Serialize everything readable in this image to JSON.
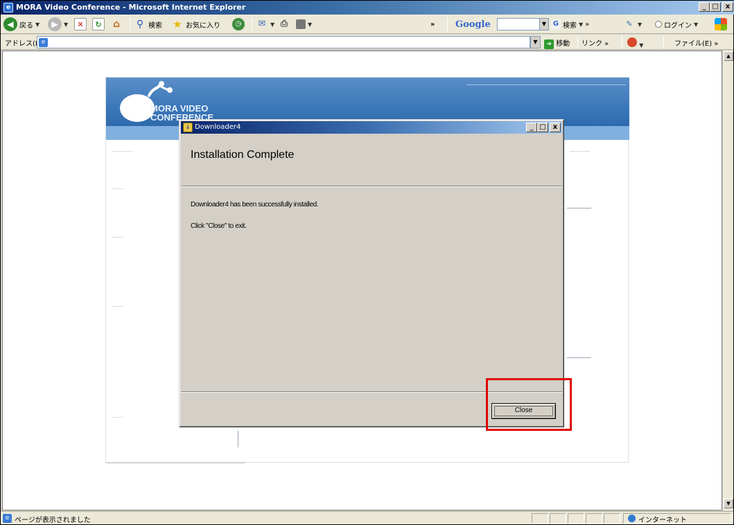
{
  "browser": {
    "title": "MORA Video Conference - Microsoft Internet Explorer",
    "controls": {
      "minimize": "_",
      "maximize": "□",
      "close": "x"
    }
  },
  "toolbar": {
    "back": "戻る",
    "search": "検索",
    "favorites": "お気に入り",
    "google_logo": "Google",
    "google_search": "検索",
    "login": "ログイン",
    "more": "»"
  },
  "address_bar": {
    "label": "アドレス(D)",
    "value": "",
    "go": "移動",
    "links": "リンク »",
    "file": "ファイル(E) »"
  },
  "webpage": {
    "logo_line1": "MORA VIDEO",
    "logo_line2": "CONFERENCE"
  },
  "dialog": {
    "title": "Downloader4",
    "heading": "Installation Complete",
    "message1": "Downloader4 has been successfully installed.",
    "message2": "Click \"Close\" to exit.",
    "close_button": "Close",
    "controls": {
      "minimize": "_",
      "maximize": "□",
      "close": "x"
    }
  },
  "statusbar": {
    "text": "ページが表示されました",
    "zone": "インターネット"
  },
  "highlight": {
    "color": "#e00000",
    "target": "close-button"
  }
}
